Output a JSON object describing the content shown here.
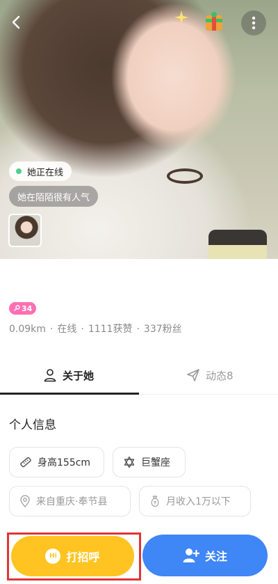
{
  "hero": {
    "online_status": "她正在线",
    "popularity_note": "她在陌陌很有人气"
  },
  "profile": {
    "level": "34",
    "stats": [
      "0.09km",
      "在线",
      "1111获赞",
      "337粉丝"
    ]
  },
  "tabs": [
    {
      "label": "关于她",
      "icon": "person-icon",
      "active": true
    },
    {
      "label": "动态8",
      "icon": "paper-plane-icon",
      "active": false
    }
  ],
  "info": {
    "title": "个人信息",
    "height": "身高155cm",
    "zodiac": "巨蟹座",
    "hometown": "来自重庆·奉节县",
    "income": "月收入1万以下"
  },
  "actions": {
    "greet_label": "打招呼",
    "greet_icon_text": "Hi",
    "follow_label": "关注"
  },
  "colors": {
    "greet": "#ffc421",
    "follow": "#3f86f6",
    "level_badge": "#ff6fb3",
    "online_dot": "#4cd08a",
    "highlight_frame": "#e03535"
  }
}
